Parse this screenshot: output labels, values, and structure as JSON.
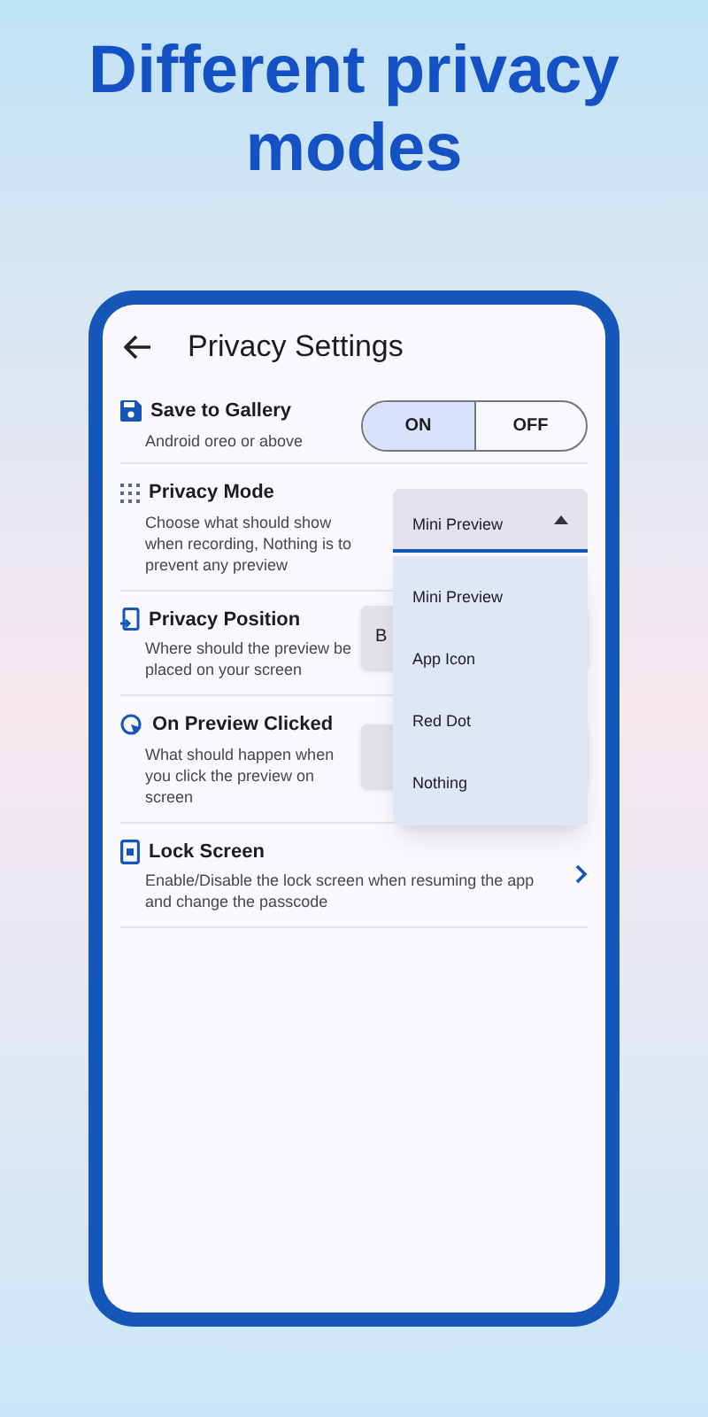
{
  "headline": "Different privacy modes",
  "screen": {
    "title": "Privacy Settings"
  },
  "settings": [
    {
      "kind": "toggle",
      "title": "Save to Gallery",
      "description": "Android oreo or above",
      "options": [
        {
          "label": "ON",
          "selected": true
        },
        {
          "label": "OFF",
          "selected": false
        }
      ]
    },
    {
      "kind": "dropdown",
      "title": "Privacy Mode",
      "description": "Choose what should show when recording, Nothing is to prevent any preview",
      "value": "Mini Preview",
      "expanded": true,
      "menu": [
        "Mini Preview",
        "App Icon",
        "Red Dot",
        "Nothing"
      ]
    },
    {
      "kind": "button",
      "title": "Privacy Position",
      "description": "Where should the preview be placed on your screen",
      "button": "B"
    },
    {
      "kind": "button",
      "title": "On Preview Clicked",
      "description": "What should happen when you click the preview on screen"
    },
    {
      "kind": "link",
      "title": "Lock Screen",
      "description": "Enable/Disable the lock screen when resuming the app and change the passcode"
    }
  ]
}
